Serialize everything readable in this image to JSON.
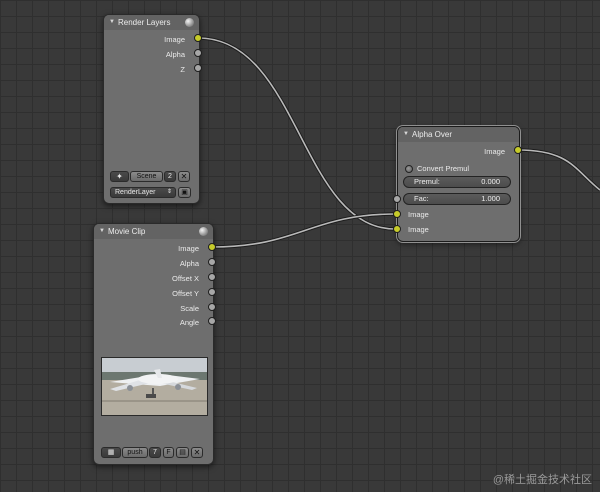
{
  "nodes": {
    "render_layers": {
      "title": "Render Layers",
      "outputs": [
        "Image",
        "Alpha",
        "Z"
      ],
      "scene_label": "Scene",
      "scene_users": "2",
      "layer_value": "RenderLayer"
    },
    "movie_clip": {
      "title": "Movie Clip",
      "outputs": [
        "Image",
        "Alpha",
        "Offset X",
        "Offset Y",
        "Scale",
        "Angle"
      ],
      "clip_name": "push",
      "clip_users": "7",
      "fake_user_label": "F"
    },
    "alpha_over": {
      "title": "Alpha Over",
      "output": "Image",
      "convert_premul_label": "Convert Premul",
      "premul": {
        "label": "Premul:",
        "value": "0.000"
      },
      "fac": {
        "label": "Fac:",
        "value": "1.000"
      },
      "inputs": [
        "Image",
        "Image"
      ]
    }
  },
  "colors": {
    "image_socket": "#c6cb2a",
    "value_socket": "#a7a7a7",
    "link": "#b9b9b9"
  },
  "watermark": "@稀土掘金技术社区"
}
